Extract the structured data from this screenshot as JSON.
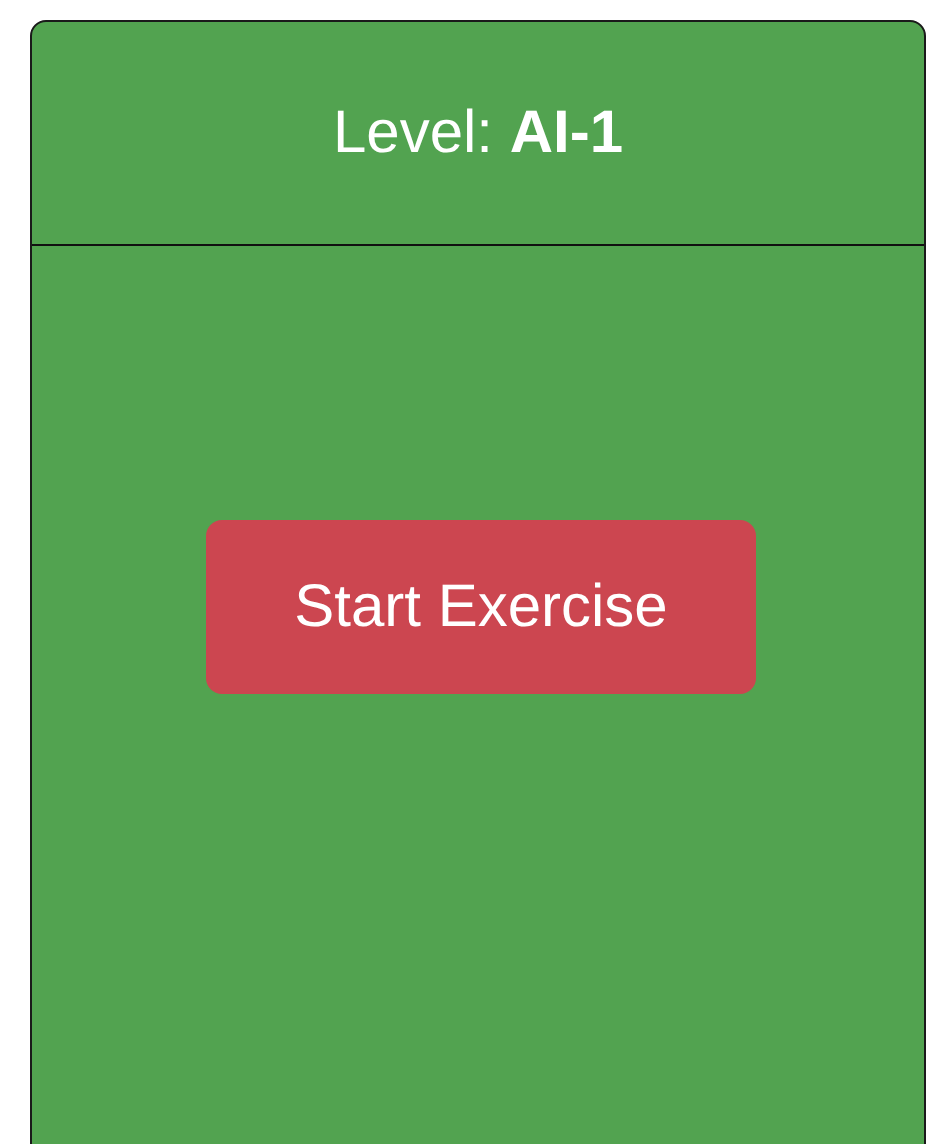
{
  "card": {
    "title": "Level: **AI-1**"
  },
  "button": {
    "label": "Start Exercise"
  }
}
